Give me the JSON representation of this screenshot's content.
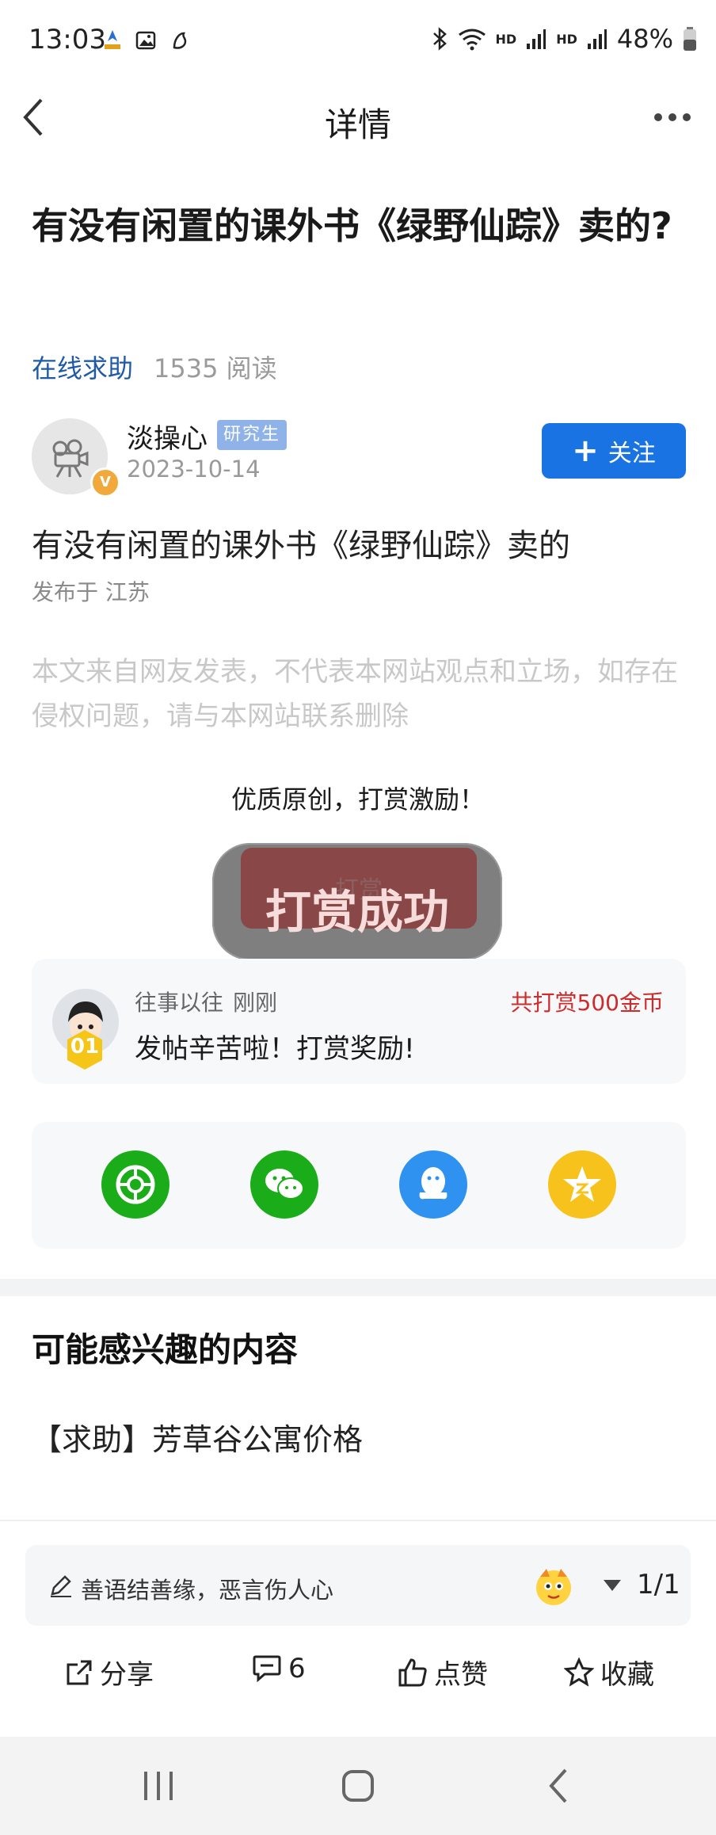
{
  "status_bar": {
    "time": "13:03",
    "battery": "48%",
    "hd1": "HD",
    "hd2": "HD"
  },
  "nav": {
    "title": "详情"
  },
  "post": {
    "title": "有没有闲置的课外书《绿野仙踪》卖的?",
    "category": "在线求助",
    "reads": "1535 阅读",
    "body": "有没有闲置的课外书《绿野仙踪》卖的",
    "location": "发布于 江苏",
    "disclaimer": "本文来自网友发表，不代表本网站观点和立场，如存在侵权问题，请与本网站联系删除"
  },
  "author": {
    "name": "淡操心",
    "badge": "研究生",
    "date": "2023-10-14",
    "verified_mark": "V",
    "follow_label": "关注"
  },
  "reward": {
    "prompt": "优质原创，打赏激励！",
    "button_label": "打赏",
    "toast": "打赏成功",
    "record": {
      "user": "往事以往",
      "time": "刚刚",
      "total": "共打赏500金币",
      "message": "发帖辛苦啦！打赏奖励!",
      "rank": "01"
    }
  },
  "share_targets": [
    "moments-icon",
    "wechat-icon",
    "qq-icon",
    "qzone-icon"
  ],
  "related": {
    "heading": "可能感兴趣的内容",
    "items": [
      "【求助】芳草谷公寓价格"
    ]
  },
  "comment": {
    "placeholder": "善语结善缘，恶言伤人心",
    "page": "1/1"
  },
  "actions": {
    "share": "分享",
    "comments": "6",
    "like": "点赞",
    "favorite": "收藏"
  },
  "colors": {
    "accent": "#1a73e2",
    "category": "#1e5aa8",
    "reward_red": "#d12a2a"
  }
}
